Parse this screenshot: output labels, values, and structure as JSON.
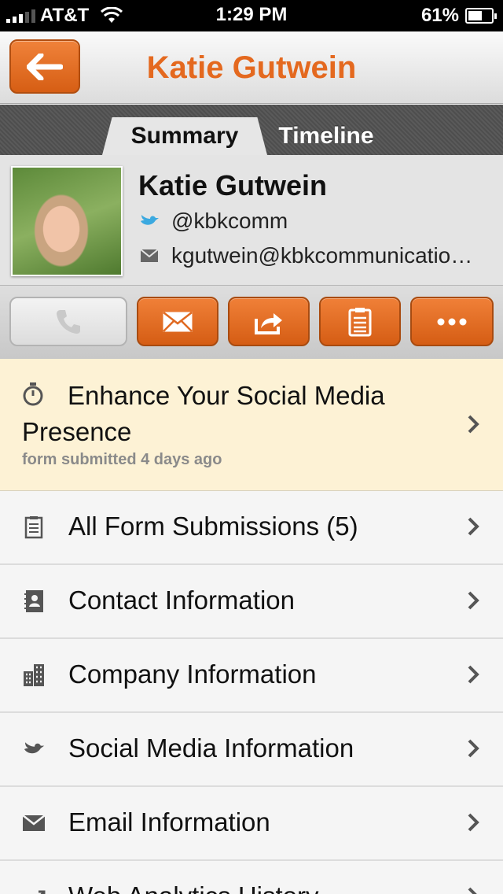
{
  "status": {
    "carrier": "AT&T",
    "time": "1:29 PM",
    "battery": "61%",
    "battery_level": 0.61
  },
  "nav": {
    "back_icon": "back-arrow-icon",
    "title": "Katie Gutwein"
  },
  "tabs": [
    {
      "label": "Summary",
      "active": true
    },
    {
      "label": "Timeline",
      "active": false
    }
  ],
  "profile": {
    "name": "Katie Gutwein",
    "twitter": "@kbkcomm",
    "email": "kgutwein@kbkcommunicatio…"
  },
  "actions": [
    {
      "icon": "phone-icon",
      "enabled": false
    },
    {
      "icon": "mail-icon",
      "enabled": true
    },
    {
      "icon": "share-icon",
      "enabled": true
    },
    {
      "icon": "notes-icon",
      "enabled": true
    },
    {
      "icon": "more-icon",
      "enabled": true
    }
  ],
  "highlight": {
    "title": "Enhance Your Social Media Presence",
    "meta": "form submitted 4 days ago",
    "icon": "timer-icon"
  },
  "list": [
    {
      "label": "All Form Submissions (5)",
      "icon": "form-icon"
    },
    {
      "label": "Contact Information",
      "icon": "contact-book-icon"
    },
    {
      "label": "Company Information",
      "icon": "building-icon"
    },
    {
      "label": "Social Media Information",
      "icon": "bird-icon"
    },
    {
      "label": "Email Information",
      "icon": "envelope-icon"
    },
    {
      "label": "Web Analytics History",
      "icon": "analytics-icon"
    }
  ],
  "colors": {
    "accent": "#e4691f",
    "button_orange": "#e06a22",
    "highlight_bg": "#fdf2d5",
    "twitter_blue": "#3ba9e0"
  }
}
